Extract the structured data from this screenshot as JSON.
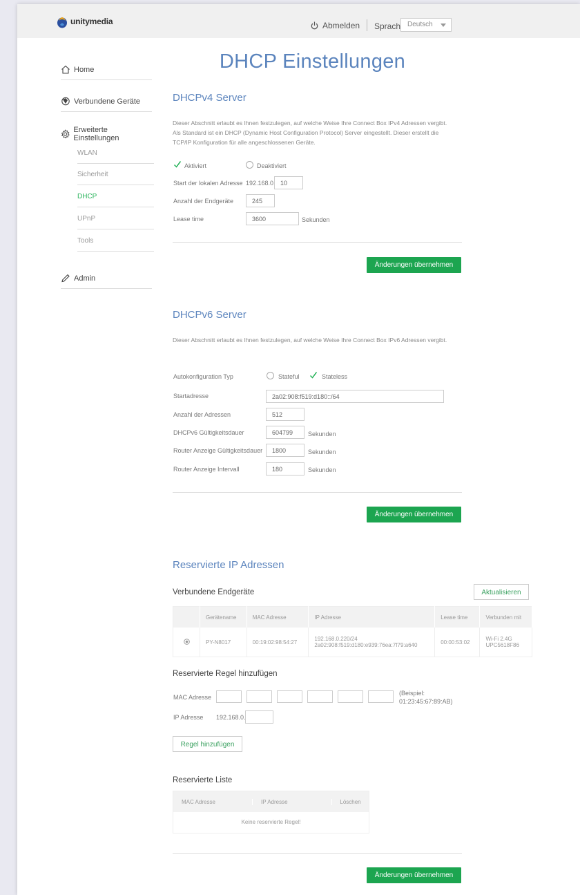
{
  "header": {
    "brand": "unitymedia",
    "logout": "Abmelden",
    "language_label": "Sprache",
    "language_value": "Deutsch"
  },
  "page_title": "DHCP Einstellungen",
  "sidebar": {
    "home": "Home",
    "devices": "Verbundene Geräte",
    "advanced": "Erweiterte Einstellungen",
    "sub": [
      "WLAN",
      "Sicherheit",
      "DHCP",
      "UPnP",
      "Tools"
    ],
    "admin": "Admin"
  },
  "dhcpv4": {
    "title": "DHCPv4 Server",
    "description": "Dieser Abschnitt erlaubt es Ihnen festzulegen, auf welche Weise Ihre Connect Box IPv4 Adressen vergibt. Als Standard ist ein DHCP (Dynamic Host Configuration Protocol) Server eingestellt. Dieser erstellt die TCP/IP Konfiguration für alle angeschlossenen Geräte.",
    "enabled": "Aktiviert",
    "disabled": "Deaktiviert",
    "start_label": "Start der lokalen Adresse",
    "start_prefix": "192.168.0.",
    "start_value": "10",
    "count_label": "Anzahl der Endgeräte",
    "count_value": "245",
    "lease_label": "Lease time",
    "lease_value": "3600",
    "lease_unit": "Sekunden",
    "apply": "Änderungen übernehmen"
  },
  "dhcpv6": {
    "title": "DHCPv6 Server",
    "description": "Dieser Abschnitt erlaubt es Ihnen festzulegen, auf welche Weise Ihre Connect Box IPv6 Adressen vergibt.",
    "autoconf_label": "Autokonfiguration Typ",
    "stateful": "Stateful",
    "stateless": "Stateless",
    "start_label": "Startadresse",
    "start_value": "2a02:908:f519:d180::/64",
    "count_label": "Anzahl der Adressen",
    "count_value": "512",
    "valid_label": "DHCPv6 Gültigkeitsdauer",
    "valid_value": "604799",
    "router_valid_label": "Router Anzeige Gültigkeitsdauer",
    "router_valid_value": "1800",
    "router_interval_label": "Router Anzeige Intervall",
    "router_interval_value": "180",
    "unit": "Sekunden",
    "apply": "Änderungen übernehmen"
  },
  "reserved": {
    "title": "Reservierte IP Adressen",
    "connected_title": "Verbundene Endgeräte",
    "refresh": "Aktualisieren",
    "columns": [
      "Gerätename",
      "MAC Adresse",
      "IP Adresse",
      "Lease time",
      "Verbunden mit"
    ],
    "rows": [
      {
        "name": "PY-N8017",
        "mac": "00:19:02:98:54:27",
        "ip1": "192.168.0.220/24",
        "ip2": "2a02:908:f519:d180:e939:76ea:7f79:a640",
        "lease": "00:00:53:02",
        "conn1": "Wi-Fi 2.4G",
        "conn2": "UPC5618F86"
      }
    ],
    "add_rule_title": "Reservierte Regel hinzufügen",
    "mac_label": "MAC Adresse",
    "mac_example": "(Beispiel: 01:23:45:67:89:AB)",
    "ip_label": "IP Adresse",
    "ip_prefix": "192.168.0.",
    "add_rule_button": "Regel hinzufügen",
    "list_title": "Reservierte Liste",
    "list_columns": [
      "MAC Adresse",
      "IP Adresse",
      "Löschen"
    ],
    "empty": "Keine reservierte Regel!",
    "apply": "Änderungen übernehmen"
  },
  "colors": {
    "accent_blue": "#5b84bd",
    "green": "#1ca550",
    "active_green": "#27b35a"
  }
}
